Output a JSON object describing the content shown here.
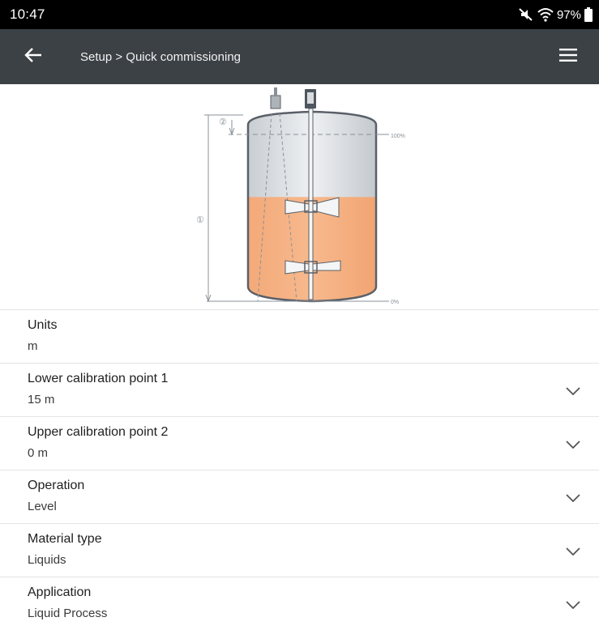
{
  "status_bar": {
    "time": "10:47",
    "battery_percent": "97%",
    "icons": [
      "mute-icon",
      "wifi-icon",
      "battery-icon"
    ]
  },
  "app_bar": {
    "breadcrumb": "Setup > Quick commissioning",
    "back_icon": "arrow-left-icon",
    "menu_icon": "hamburger-menu-icon",
    "background_color": "#3c4145"
  },
  "diagram": {
    "marker_1": "①",
    "marker_2": "②",
    "label_100": "100%",
    "label_0": "0%",
    "liquid_color": "#f7b98d",
    "liquid_level_fraction": 0.55
  },
  "settings": [
    {
      "label": "Units",
      "value": "m",
      "has_dropdown": false
    },
    {
      "label": "Lower calibration point 1",
      "value": "15  m",
      "has_dropdown": true
    },
    {
      "label": "Upper calibration point 2",
      "value": "0  m",
      "has_dropdown": true
    },
    {
      "label": "Operation",
      "value": "Level",
      "has_dropdown": true
    },
    {
      "label": "Material type",
      "value": "Liquids",
      "has_dropdown": true
    },
    {
      "label": "Application",
      "value": "Liquid Process",
      "has_dropdown": true
    }
  ]
}
